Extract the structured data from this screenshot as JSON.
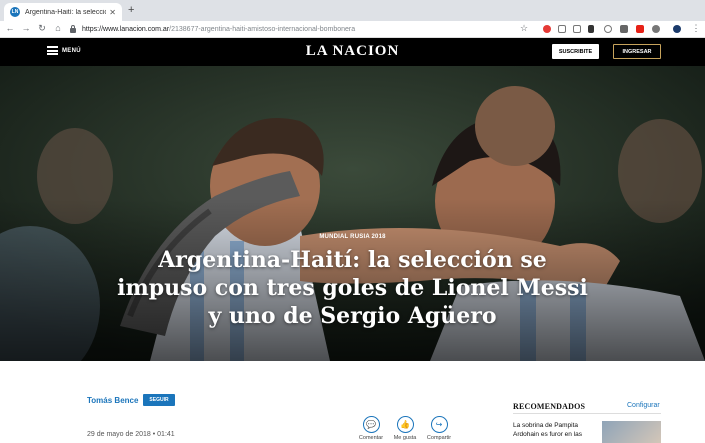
{
  "browser": {
    "tab_title": "Argentina-Haití: la selección se",
    "tab_close": "✕",
    "new_tab": "+",
    "url_host": "https://www.lanacion.com.ar",
    "url_path": "/2138677-argentina-haiti-amistoso-internacional-bombonera",
    "favicon_text": "LN"
  },
  "header": {
    "menu_label": "MENÚ",
    "logo": "LA NACION",
    "subscribe_label": "SUSCRIBITE",
    "login_label": "INGRESAR"
  },
  "hero": {
    "kicker": "MUNDIAL RUSIA 2018",
    "headline": "Argentina-Haití: la selección se impuso con tres goles de Lionel Messi y uno de Sergio Agüero"
  },
  "article": {
    "author": "Tomás Bence",
    "follow_label": "SEGUIR",
    "date": "29 de mayo de 2018  •  01:41",
    "actions": [
      {
        "label": "Comentar",
        "icon": "comment-icon",
        "glyph": "💬"
      },
      {
        "label": "Me gusta",
        "icon": "like-icon",
        "glyph": "👍"
      },
      {
        "label": "Compartir",
        "icon": "share-icon",
        "glyph": "↪"
      }
    ]
  },
  "sidebar": {
    "title": "RECOMENDADOS",
    "config_label": "Configurar",
    "item_text": "La sobrina de Pampita Ardohain es furor en las"
  },
  "colors": {
    "brand_blue": "#1b75bb",
    "header_bg": "#000000",
    "login_border": "#c7a35c"
  }
}
